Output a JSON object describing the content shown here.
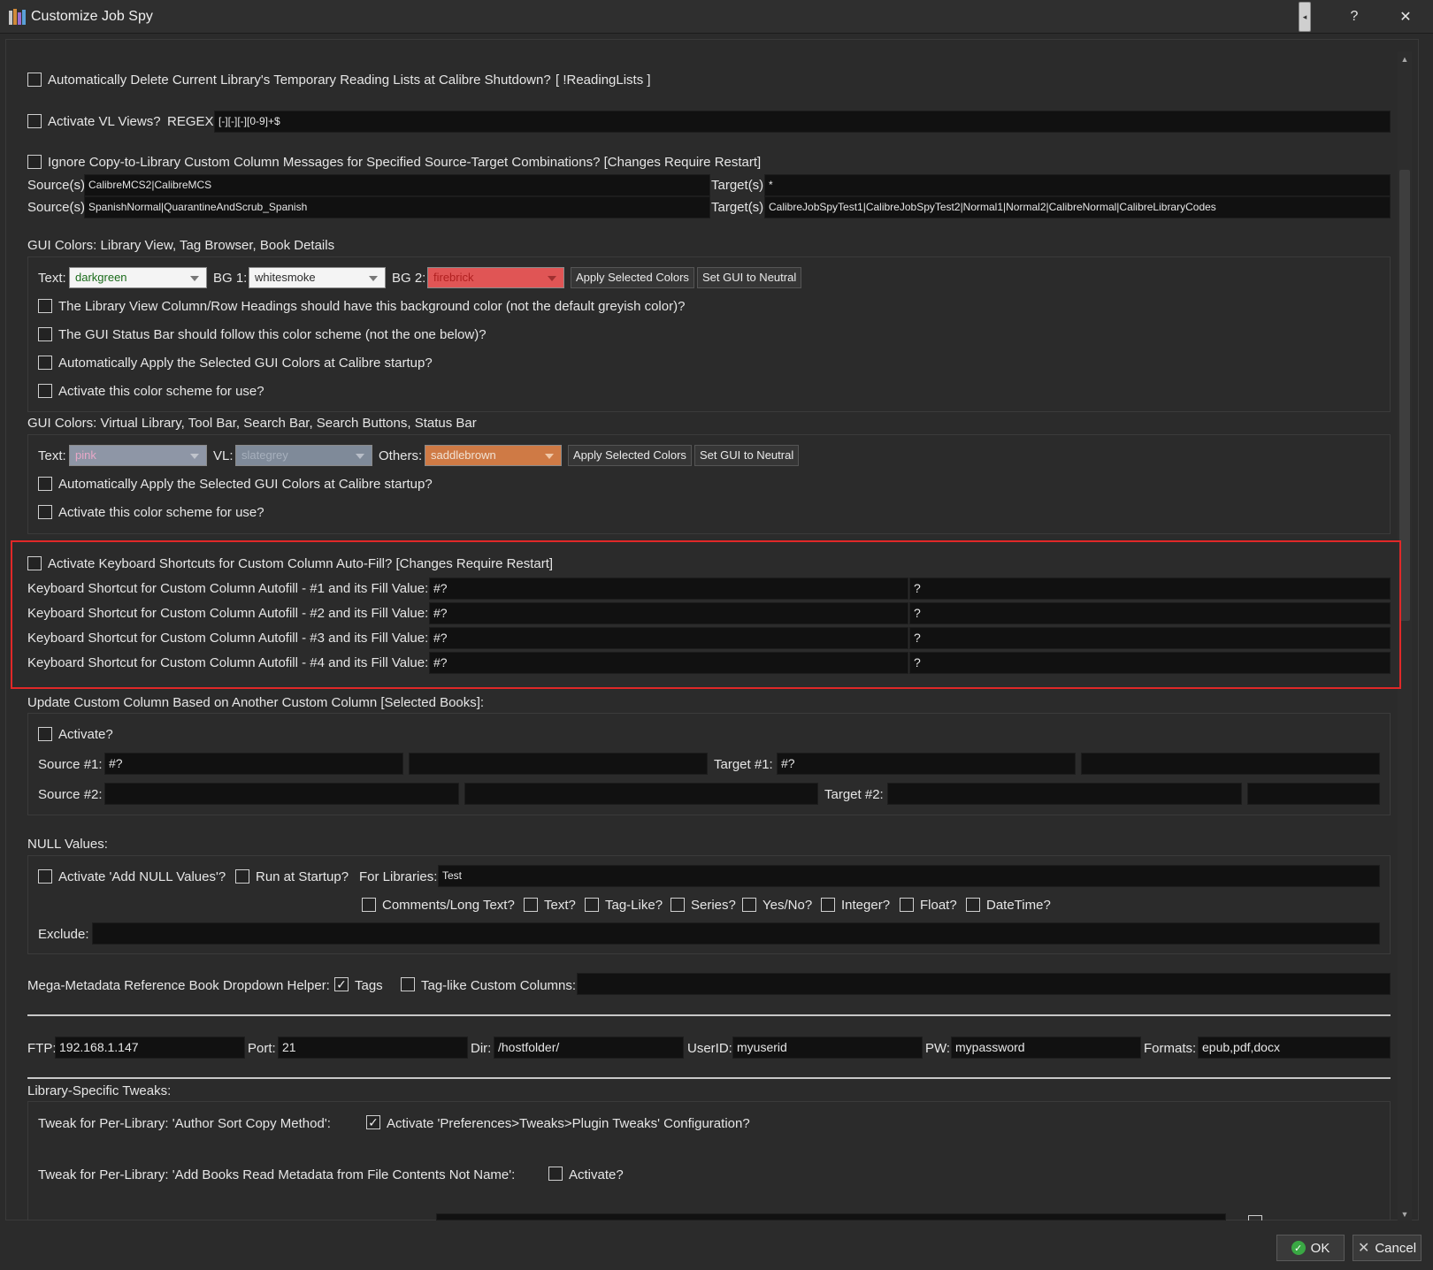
{
  "window": {
    "title": "Customize Job Spy",
    "help_label": "?",
    "close_label": "✕"
  },
  "reading_lists": {
    "label": "Automatically Delete Current Library's Temporary Reading Lists at Calibre Shutdown?",
    "suffix": "[ !ReadingLists ]"
  },
  "vl_views": {
    "label": "Activate VL Views?",
    "regex_label": "REGEX:",
    "regex_value": "[-][-][-][0-9]+$"
  },
  "copy_to_library": {
    "label": "Ignore Copy-to-Library Custom Column Messages for Specified Source-Target Combinations? [Changes Require Restart]",
    "source_label": "Source(s):",
    "target_label": "Target(s):",
    "rows": [
      {
        "source": "CalibreMCS2|CalibreMCS",
        "target": "*"
      },
      {
        "source": "SpanishNormal|QuarantineAndScrub_Spanish",
        "target": "CalibreJobSpyTest1|CalibreJobSpyTest2|Normal1|Normal2|CalibreNormal|CalibreLibraryCodes"
      }
    ]
  },
  "gui_colors_1": {
    "title": "GUI Colors: Library View, Tag Browser, Book Details",
    "text_label": "Text:",
    "text_value": "darkgreen",
    "bg1_label": "BG 1:",
    "bg1_value": "whitesmoke",
    "bg2_label": "BG 2:",
    "bg2_value": "firebrick",
    "apply_label": "Apply Selected Colors",
    "neutral_label": "Set GUI to Neutral",
    "options": [
      "The Library View Column/Row Headings should have this background color (not the default greyish color)?",
      "The GUI Status Bar should follow this color scheme (not the one below)?",
      "Automatically Apply the Selected GUI Colors at Calibre startup?",
      "Activate this color scheme for use?"
    ]
  },
  "gui_colors_2": {
    "title": "GUI Colors: Virtual Library, Tool Bar, Search Bar, Search Buttons, Status Bar",
    "text_label": "Text:",
    "text_value": "pink",
    "vl_label": "VL:",
    "vl_value": "slategrey",
    "others_label": "Others:",
    "others_value": "saddlebrown",
    "apply_label": "Apply Selected Colors",
    "neutral_label": "Set GUI to Neutral",
    "options": [
      "Automatically Apply the Selected GUI Colors at Calibre startup?",
      "Activate this color scheme for use?"
    ]
  },
  "shortcuts": {
    "label": "Activate Keyboard Shortcuts for Custom Column Auto-Fill? [Changes Require Restart]",
    "rows": [
      {
        "label": "Keyboard Shortcut for Custom Column Autofill - #1 and its Fill Value:",
        "column": "#?",
        "value": "?"
      },
      {
        "label": "Keyboard Shortcut for Custom Column Autofill - #2 and its Fill Value:",
        "column": "#?",
        "value": "?"
      },
      {
        "label": "Keyboard Shortcut for Custom Column Autofill - #3 and its Fill Value:",
        "column": "#?",
        "value": "?"
      },
      {
        "label": "Keyboard Shortcut for Custom Column Autofill - #4 and its Fill Value:",
        "column": "#?",
        "value": "?"
      }
    ]
  },
  "update_cc": {
    "title": "Update Custom Column Based on Another Custom Column [Selected Books]:",
    "activate_label": "Activate?",
    "source1_label": "Source #1:",
    "source1_value": "#?",
    "target1_label": "Target #1:",
    "target1_value": "#?",
    "source2_label": "Source #2:",
    "target2_label": "Target #2:"
  },
  "null_values": {
    "title": "NULL Values:",
    "activate_label": "Activate 'Add NULL Values'?",
    "startup_label": "Run at Startup?",
    "libraries_label": "For Libraries:",
    "libraries_value": "Test",
    "types": [
      "Comments/Long Text?",
      "Text?",
      "Tag-Like?",
      "Series?",
      "Yes/No?",
      "Integer?",
      "Float?",
      "DateTime?"
    ],
    "exclude_label": "Exclude:"
  },
  "mega_metadata": {
    "label": "Mega-Metadata Reference Book Dropdown Helper:",
    "tags_label": "Tags",
    "taglike_label": "Tag-like Custom Columns:"
  },
  "ftp": {
    "ftp_label": "FTP:",
    "ftp_value": "192.168.1.147",
    "port_label": "Port:",
    "port_value": "21",
    "dir_label": "Dir:",
    "dir_value": "/hostfolder/",
    "user_label": "UserID:",
    "user_value": "myuserid",
    "pw_label": "PW:",
    "pw_value": "mypassword",
    "formats_label": "Formats:",
    "formats_value": "epub,pdf,docx"
  },
  "tweaks": {
    "title": "Library-Specific Tweaks:",
    "author_label": "Tweak for Per-Library: 'Author Sort Copy Method':",
    "author_option": "Activate 'Preferences>Tweaks>Plugin Tweaks' Configuration?",
    "addbooks_label": "Tweak for Per-Library: 'Add Books Read Metadata from File Contents Not Name':",
    "addbooks_option": "Activate?"
  },
  "footer": {
    "ok_label": "OK",
    "cancel_label": "Cancel"
  },
  "colors": {
    "accent_red": "#e02828",
    "firebrick": "#e05555",
    "saddlebrown": "#cf7a45",
    "slategrey": "#7f8a99",
    "pink": "#8e96a6"
  }
}
